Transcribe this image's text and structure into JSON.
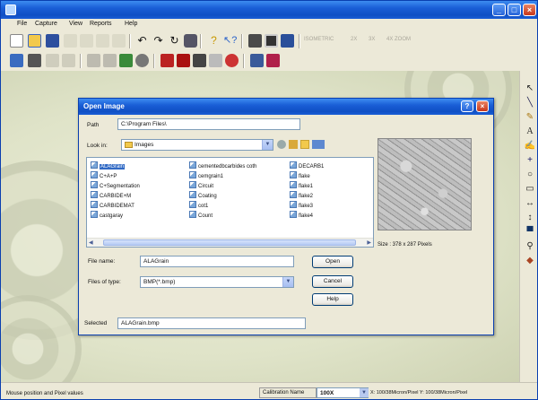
{
  "menu": [
    "File",
    "Capture",
    "View",
    "Reports",
    "Help"
  ],
  "toolbar1_labels": [
    "ISOMETRIC",
    "2X",
    "3X",
    "4X ZOOM"
  ],
  "dialog": {
    "title": "Open Image",
    "path_label": "Path",
    "path_value": "C:\\Program Files\\",
    "lookin_label": "Look in:",
    "lookin_value": "Images",
    "files": [
      [
        "ALAGrain",
        "C+A+P",
        "C+Segmentation",
        "CARBIDE+M",
        "CARBIDEMAT",
        "castgaray"
      ],
      [
        "cementedbcarbides coth",
        "cemgrain1",
        "Circuit",
        "Coating",
        "cot1",
        "Count"
      ],
      [
        "DECARB1",
        "flake",
        "flake1",
        "flake2",
        "flake3",
        "flake4"
      ]
    ],
    "selected_file": "ALAGrain",
    "preview_size": "Size : 378 x 287 Pixels",
    "filename_label": "File name:",
    "filename_value": "ALAGrain",
    "filetype_label": "Files of type:",
    "filetype_value": "BMP(*.bmp)",
    "open_button": "Open",
    "cancel_button": "Cancel",
    "help_button": "Help",
    "selected_label": "Selected",
    "selected_value": "ALAGrain.bmp"
  },
  "status": {
    "left": "Mouse position and Pixel values",
    "calibration_label": "Calibration Name",
    "calibration_value": "100X",
    "calibration_info": "X: 100/38Micron/Pixel Y: 100/38Micron/Pixel"
  }
}
